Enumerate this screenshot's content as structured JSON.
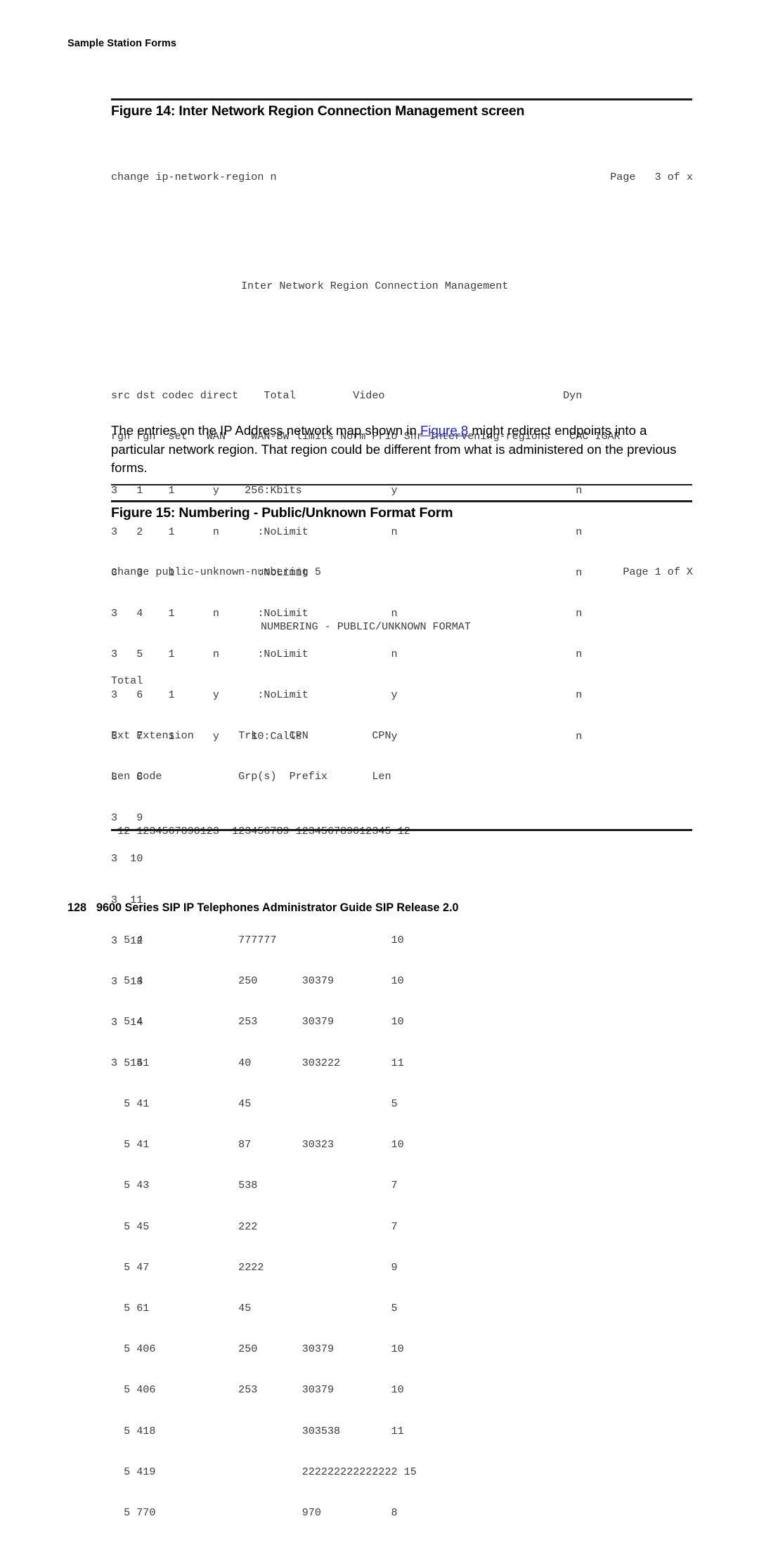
{
  "running_head": "Sample Station Forms",
  "figure14": {
    "caption": "Figure 14: Inter Network Region Connection Management screen",
    "command": "change ip-network-region n",
    "page_indicator": "Page   3 of x",
    "screen_title": "Inter Network Region Connection Management",
    "header_line_1": "src dst codec direct    Total         Video                            Dyn",
    "header_line_2": "rgn rgn  set   WAN    WAN-BW limits Norm Prio Shr Intervening-regions   CAC IGAR",
    "columns": [
      "src rgn",
      "dst rgn",
      "codec set",
      "direct WAN",
      "Total WAN-BW limits",
      "Video Norm",
      "Video Prio",
      "Video Shr",
      "Intervening-regions",
      "Dyn CAC",
      "IGAR"
    ],
    "rows": [
      {
        "src_rgn": "3",
        "dst_rgn": "1",
        "codec_set": "1",
        "direct_wan": "y",
        "wan_bw_limits": "256:Kbits",
        "video_norm": "y",
        "video_prio": "",
        "video_shr": "",
        "intervening_regions": "",
        "dyn_cac": "",
        "igar": "n"
      },
      {
        "src_rgn": "3",
        "dst_rgn": "2",
        "codec_set": "1",
        "direct_wan": "n",
        "wan_bw_limits": ":NoLimit",
        "video_norm": "n",
        "video_prio": "",
        "video_shr": "",
        "intervening_regions": "",
        "dyn_cac": "",
        "igar": "n"
      },
      {
        "src_rgn": "3",
        "dst_rgn": "3",
        "codec_set": "1",
        "direct_wan": "",
        "wan_bw_limits": ":NoLimit",
        "video_norm": "",
        "video_prio": "",
        "video_shr": "",
        "intervening_regions": "",
        "dyn_cac": "",
        "igar": "n"
      },
      {
        "src_rgn": "3",
        "dst_rgn": "4",
        "codec_set": "1",
        "direct_wan": "n",
        "wan_bw_limits": ":NoLimit",
        "video_norm": "n",
        "video_prio": "",
        "video_shr": "",
        "intervening_regions": "",
        "dyn_cac": "",
        "igar": "n"
      },
      {
        "src_rgn": "3",
        "dst_rgn": "5",
        "codec_set": "1",
        "direct_wan": "n",
        "wan_bw_limits": ":NoLimit",
        "video_norm": "n",
        "video_prio": "",
        "video_shr": "",
        "intervening_regions": "",
        "dyn_cac": "",
        "igar": "n"
      },
      {
        "src_rgn": "3",
        "dst_rgn": "6",
        "codec_set": "1",
        "direct_wan": "y",
        "wan_bw_limits": ":NoLimit",
        "video_norm": "y",
        "video_prio": "",
        "video_shr": "",
        "intervening_regions": "",
        "dyn_cac": "",
        "igar": "n"
      },
      {
        "src_rgn": "3",
        "dst_rgn": "7",
        "codec_set": "1",
        "direct_wan": "y",
        "wan_bw_limits": "10:Calls",
        "video_norm": "y",
        "video_prio": "",
        "video_shr": "",
        "intervening_regions": "",
        "dyn_cac": "",
        "igar": "n"
      },
      {
        "src_rgn": "3",
        "dst_rgn": "8",
        "codec_set": "",
        "direct_wan": "",
        "wan_bw_limits": "",
        "video_norm": "",
        "video_prio": "",
        "video_shr": "",
        "intervening_regions": "",
        "dyn_cac": "",
        "igar": ""
      },
      {
        "src_rgn": "3",
        "dst_rgn": "9",
        "codec_set": "",
        "direct_wan": "",
        "wan_bw_limits": "",
        "video_norm": "",
        "video_prio": "",
        "video_shr": "",
        "intervening_regions": "",
        "dyn_cac": "",
        "igar": ""
      },
      {
        "src_rgn": "3",
        "dst_rgn": "10",
        "codec_set": "",
        "direct_wan": "",
        "wan_bw_limits": "",
        "video_norm": "",
        "video_prio": "",
        "video_shr": "",
        "intervening_regions": "",
        "dyn_cac": "",
        "igar": ""
      },
      {
        "src_rgn": "3",
        "dst_rgn": "11",
        "codec_set": "",
        "direct_wan": "",
        "wan_bw_limits": "",
        "video_norm": "",
        "video_prio": "",
        "video_shr": "",
        "intervening_regions": "",
        "dyn_cac": "",
        "igar": ""
      },
      {
        "src_rgn": "3",
        "dst_rgn": "12",
        "codec_set": "",
        "direct_wan": "",
        "wan_bw_limits": "",
        "video_norm": "",
        "video_prio": "",
        "video_shr": "",
        "intervening_regions": "",
        "dyn_cac": "",
        "igar": ""
      },
      {
        "src_rgn": "3",
        "dst_rgn": "13",
        "codec_set": "",
        "direct_wan": "",
        "wan_bw_limits": "",
        "video_norm": "",
        "video_prio": "",
        "video_shr": "",
        "intervening_regions": "",
        "dyn_cac": "",
        "igar": ""
      },
      {
        "src_rgn": "3",
        "dst_rgn": "14",
        "codec_set": "",
        "direct_wan": "",
        "wan_bw_limits": "",
        "video_norm": "",
        "video_prio": "",
        "video_shr": "",
        "intervening_regions": "",
        "dyn_cac": "",
        "igar": ""
      },
      {
        "src_rgn": "3",
        "dst_rgn": "15",
        "codec_set": "",
        "direct_wan": "",
        "wan_bw_limits": "",
        "video_norm": "",
        "video_prio": "",
        "video_shr": "",
        "intervening_regions": "",
        "dyn_cac": "",
        "igar": ""
      }
    ],
    "rendered_lines": [
      "3   1    1      y    256:Kbits              y                            n",
      "3   2    1      n      :NoLimit             n                            n",
      "3   3    1             :NoLimit                                          n",
      "3   4    1      n      :NoLimit             n                            n",
      "3   5    1      n      :NoLimit             n                            n",
      "3   6    1      y      :NoLimit             y                            n",
      "3   7    1      y     10:Calls              y                            n",
      "3   8",
      "3   9",
      "3  10",
      "3  11",
      "3  12",
      "3  13",
      "3  14",
      "3  15"
    ]
  },
  "paragraph": {
    "text_before": "The entries on the IP Address network map shown in ",
    "link_text": "Figure 8",
    "text_after": " might redirect endpoints into a particular network region. That region could be different from what is administered on the previous forms."
  },
  "figure15": {
    "caption": "Figure 15: Numbering - Public/Unknown Format Form",
    "command": "change public-unknown-numbering 5",
    "page_indicator": "Page 1 of X",
    "screen_title": "NUMBERING - PUBLIC/UNKNOWN FORMAT",
    "total_label": "Total",
    "header_line_1": "Ext Extension       Trk     CPN          CPN",
    "header_line_2": "Len Code            Grp(s)  Prefix       Len",
    "ruler_line": " 12 1234567890123  123456789 123456789012345 12",
    "columns": [
      "Total Ext Len",
      "Extension Code",
      "Trk Grp(s)",
      "CPN Prefix",
      "CPN Len"
    ],
    "rows": [
      {
        "ext_len": "5",
        "ext_code": "4",
        "trk_grps": "777777",
        "cpn_prefix": "",
        "cpn_len": "10"
      },
      {
        "ext_len": "5",
        "ext_code": "4",
        "trk_grps": "250",
        "cpn_prefix": "30379",
        "cpn_len": "10"
      },
      {
        "ext_len": "5",
        "ext_code": "4",
        "trk_grps": "253",
        "cpn_prefix": "30379",
        "cpn_len": "10"
      },
      {
        "ext_len": "5",
        "ext_code": "41",
        "trk_grps": "40",
        "cpn_prefix": "303222",
        "cpn_len": "11"
      },
      {
        "ext_len": "5",
        "ext_code": "41",
        "trk_grps": "45",
        "cpn_prefix": "",
        "cpn_len": "5"
      },
      {
        "ext_len": "5",
        "ext_code": "41",
        "trk_grps": "87",
        "cpn_prefix": "30323",
        "cpn_len": "10"
      },
      {
        "ext_len": "5",
        "ext_code": "43",
        "trk_grps": "538",
        "cpn_prefix": "",
        "cpn_len": "7"
      },
      {
        "ext_len": "5",
        "ext_code": "45",
        "trk_grps": "222",
        "cpn_prefix": "",
        "cpn_len": "7"
      },
      {
        "ext_len": "5",
        "ext_code": "47",
        "trk_grps": "2222",
        "cpn_prefix": "",
        "cpn_len": "9"
      },
      {
        "ext_len": "5",
        "ext_code": "61",
        "trk_grps": "45",
        "cpn_prefix": "",
        "cpn_len": "5"
      },
      {
        "ext_len": "5",
        "ext_code": "406",
        "trk_grps": "250",
        "cpn_prefix": "30379",
        "cpn_len": "10"
      },
      {
        "ext_len": "5",
        "ext_code": "406",
        "trk_grps": "253",
        "cpn_prefix": "30379",
        "cpn_len": "10"
      },
      {
        "ext_len": "5",
        "ext_code": "418",
        "trk_grps": "",
        "cpn_prefix": "303538",
        "cpn_len": "11"
      },
      {
        "ext_len": "5",
        "ext_code": "419",
        "trk_grps": "",
        "cpn_prefix": "222222222222222",
        "cpn_len": "15"
      },
      {
        "ext_len": "5",
        "ext_code": "770",
        "trk_grps": "",
        "cpn_prefix": "970",
        "cpn_len": "8"
      }
    ],
    "rendered_lines": [
      "  5 4               777777                  10",
      "  5 4               250       30379         10",
      "  5 4               253       30379         10",
      "  5 41              40        303222        11",
      "  5 41              45                      5",
      "  5 41              87        30323         10",
      "  5 43              538                     7",
      "  5 45              222                     7",
      "  5 47              2222                    9",
      "  5 61              45                      5",
      "  5 406             250       30379         10",
      "  5 406             253       30379         10",
      "  5 418                       303538        11",
      "  5 419                       222222222222222 15",
      "  5 770                       970           8"
    ]
  },
  "footer": {
    "page_number": "128",
    "title": "9600 Series SIP IP Telephones Administrator Guide SIP Release 2.0"
  },
  "colors": {
    "link": "#2222cc",
    "rule": "#1a1a1a",
    "terminal_text": "#3c3c3c",
    "body_text": "#000000"
  }
}
